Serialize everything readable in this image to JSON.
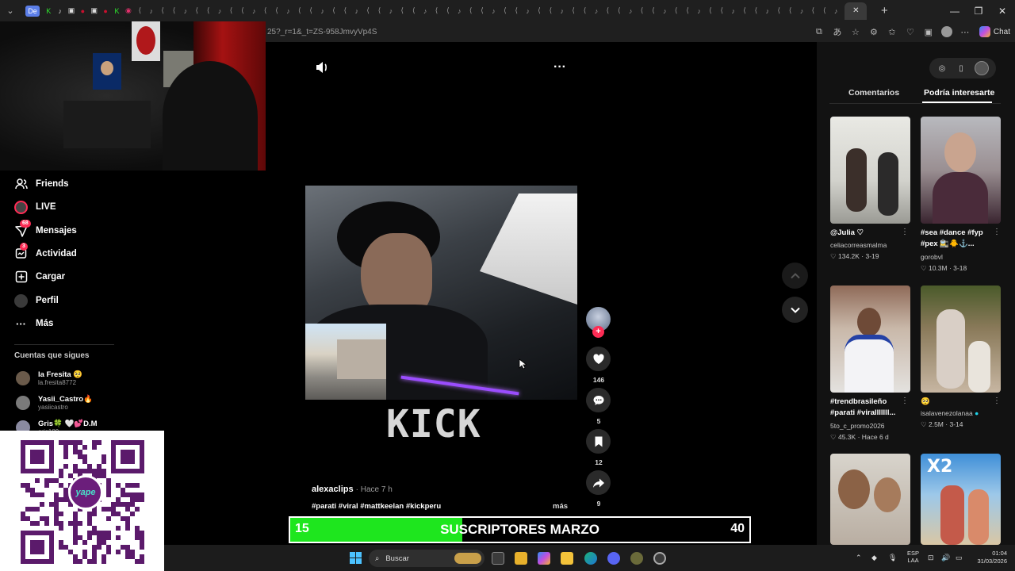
{
  "browser": {
    "profile_label": "De",
    "tab_labels": [
      "St",
      "Ki",
      "In"
    ],
    "url": "25?_r=1&_t=ZS-958JmvyVp4S",
    "chat_label": "Chat"
  },
  "sidebar": {
    "items": [
      {
        "label": "Friends",
        "icon": "friends-icon"
      },
      {
        "label": "LIVE",
        "icon": "live-icon"
      },
      {
        "label": "Mensajes",
        "icon": "messages-icon",
        "badge": "68"
      },
      {
        "label": "Actividad",
        "icon": "activity-icon",
        "badge": "3"
      },
      {
        "label": "Cargar",
        "icon": "upload-icon"
      },
      {
        "label": "Perfil",
        "icon": "profile-icon"
      },
      {
        "label": "Más",
        "icon": "more-icon"
      }
    ],
    "following_title": "Cuentas que sigues",
    "following": [
      {
        "name": "la Fresita 🥺",
        "handle": "la.fresita8772"
      },
      {
        "name": "Yasii_Castro🔥",
        "handle": "yasiicastro"
      },
      {
        "name": "Gris🍀 🤍💕D.M",
        "handle": "gris189"
      }
    ]
  },
  "qr": {
    "logo_text": "yape"
  },
  "video": {
    "watermark": "KICK",
    "author": "alexaclips",
    "time": "Hace 7 h",
    "caption": "#parati #viral #mattkeelan #kickperu",
    "more_label": "más",
    "likes": "146",
    "comments": "5",
    "saves": "12",
    "shares": "9"
  },
  "subscriber_goal": {
    "current": "15",
    "label": "SUSCRIPTORES MARZO",
    "goal": "40",
    "progress": 0.375,
    "fill_color": "#1ee61e"
  },
  "right_panel": {
    "tabs": [
      {
        "label": "Comentarios",
        "active": false
      },
      {
        "label": "Podría interesarte",
        "active": true
      }
    ],
    "cards": [
      {
        "title": "@Julia ♡",
        "author": "celiacorreasmalma",
        "likes": "134.2K",
        "date": "3-19"
      },
      {
        "title": "#sea #dance #fyp #pex 🚉🐥⚓...",
        "author": "gorobvl",
        "likes": "10.3M",
        "date": "3-18"
      },
      {
        "title": "#trendbrasileño #parati #viralllllll...",
        "author": "5to_c_promo2026",
        "likes": "45.3K",
        "date": "Hace 6 d"
      },
      {
        "title": "🥺",
        "author": "isalavenezolanaa",
        "likes": "2.5M",
        "date": "3-14"
      },
      {
        "title": "",
        "author": "",
        "likes": "",
        "date": ""
      },
      {
        "title": "",
        "author": "",
        "likes": "",
        "date": "",
        "overlay": "X2"
      }
    ]
  },
  "taskbar": {
    "search_label": "Buscar",
    "lang_line1": "ESP",
    "lang_line2": "LAA",
    "time": "01:04",
    "date": "31/03/2026"
  }
}
